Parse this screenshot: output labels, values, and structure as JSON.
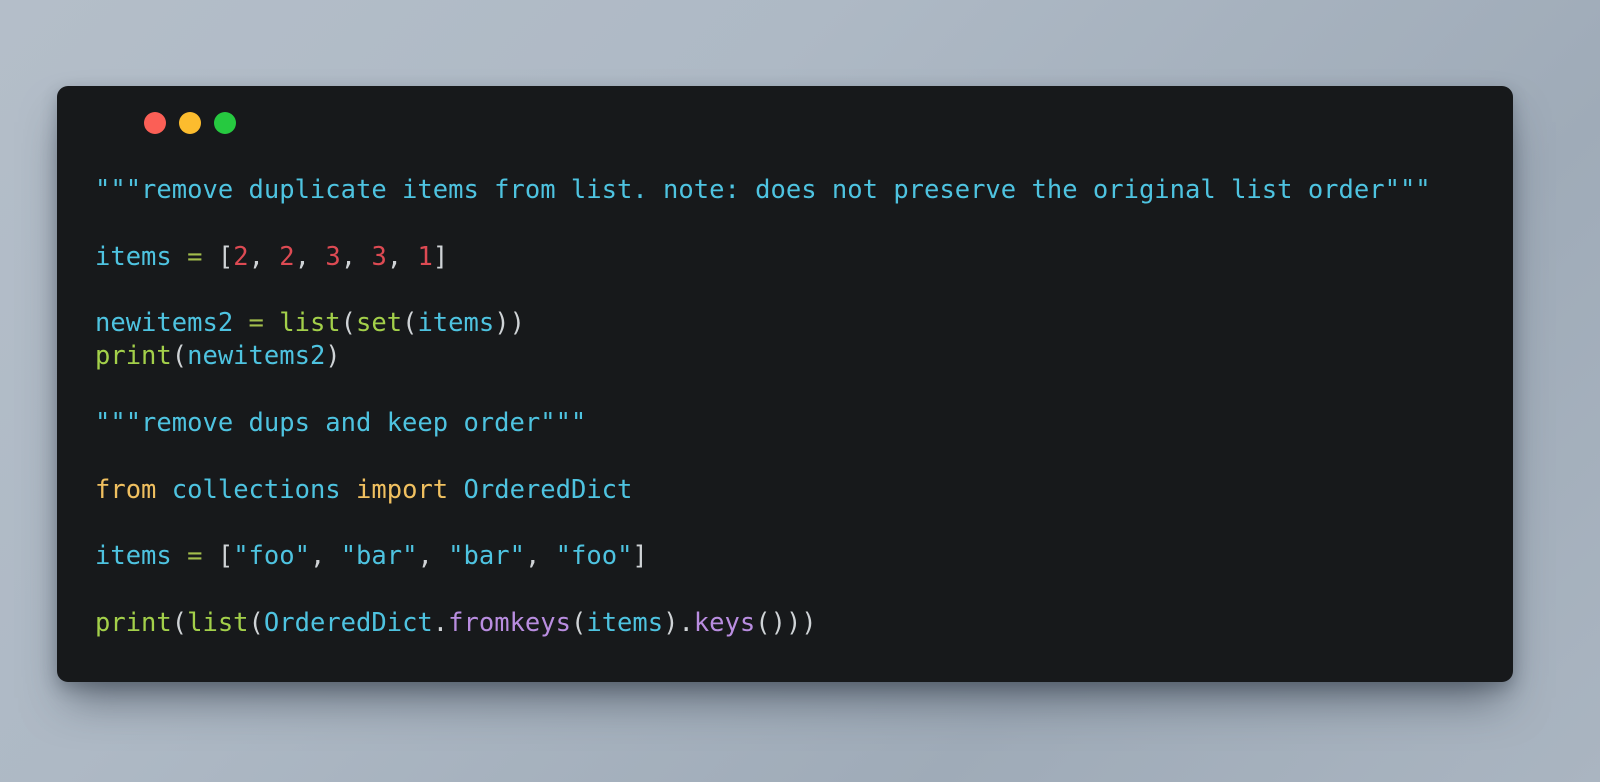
{
  "window": {
    "title": "code-snippet-window",
    "controls": [
      {
        "name": "close",
        "label": "",
        "color": "#fb5f56"
      },
      {
        "name": "minimize",
        "label": "",
        "color": "#fcbc2e"
      },
      {
        "name": "maximize",
        "label": "",
        "color": "#26c940"
      }
    ]
  },
  "theme": {
    "background": "#aeb9c5",
    "card_background": "#17191b",
    "comment": "#4ec3e0",
    "variable": "#4ec3e0",
    "string": "#4ec3e0",
    "number": "#dd4a53",
    "operator": "#a3be4c",
    "builtin": "#a3d04a",
    "keyword": "#f0c060",
    "method": "#b98de0",
    "punctuation": "#cfd3d6"
  },
  "code": {
    "language": "python",
    "plain_text": "\"\"\"remove duplicate items from list. note: does not preserve the original list order\"\"\"\n\nitems = [2, 2, 3, 3, 1]\n\nnewitems2 = list(set(items))\nprint(newitems2)\n\n\"\"\"remove dups and keep order\"\"\"\n\nfrom collections import OrderedDict\n\nitems = [\"foo\", \"bar\", \"bar\", \"foo\"]\n\nprint(list(OrderedDict.fromkeys(items).keys()))",
    "lines": [
      {
        "index": 1,
        "tokens": [
          {
            "t": "\"\"\"remove duplicate items from list. note: does not preserve the original list order\"\"\"",
            "c": "comment"
          }
        ]
      },
      {
        "index": 2,
        "tokens": []
      },
      {
        "index": 3,
        "tokens": [
          {
            "t": "items",
            "c": "var"
          },
          {
            "t": " ",
            "c": "punct"
          },
          {
            "t": "=",
            "c": "op"
          },
          {
            "t": " ",
            "c": "punct"
          },
          {
            "t": "[",
            "c": "punct"
          },
          {
            "t": "2",
            "c": "num"
          },
          {
            "t": ", ",
            "c": "punct"
          },
          {
            "t": "2",
            "c": "num"
          },
          {
            "t": ", ",
            "c": "punct"
          },
          {
            "t": "3",
            "c": "num"
          },
          {
            "t": ", ",
            "c": "punct"
          },
          {
            "t": "3",
            "c": "num"
          },
          {
            "t": ", ",
            "c": "punct"
          },
          {
            "t": "1",
            "c": "num"
          },
          {
            "t": "]",
            "c": "punct"
          }
        ]
      },
      {
        "index": 4,
        "tokens": []
      },
      {
        "index": 5,
        "tokens": [
          {
            "t": "newitems2",
            "c": "var"
          },
          {
            "t": " ",
            "c": "punct"
          },
          {
            "t": "=",
            "c": "op"
          },
          {
            "t": " ",
            "c": "punct"
          },
          {
            "t": "list",
            "c": "builtin"
          },
          {
            "t": "(",
            "c": "punct"
          },
          {
            "t": "set",
            "c": "builtin"
          },
          {
            "t": "(",
            "c": "punct"
          },
          {
            "t": "items",
            "c": "var"
          },
          {
            "t": "))",
            "c": "punct"
          }
        ]
      },
      {
        "index": 6,
        "tokens": [
          {
            "t": "print",
            "c": "builtin"
          },
          {
            "t": "(",
            "c": "punct"
          },
          {
            "t": "newitems2",
            "c": "var"
          },
          {
            "t": ")",
            "c": "punct"
          }
        ]
      },
      {
        "index": 7,
        "tokens": []
      },
      {
        "index": 8,
        "tokens": [
          {
            "t": "\"\"\"remove dups and keep order\"\"\"",
            "c": "comment"
          }
        ]
      },
      {
        "index": 9,
        "tokens": []
      },
      {
        "index": 10,
        "tokens": [
          {
            "t": "from",
            "c": "keyword"
          },
          {
            "t": " ",
            "c": "punct"
          },
          {
            "t": "collections",
            "c": "var"
          },
          {
            "t": " ",
            "c": "punct"
          },
          {
            "t": "import",
            "c": "keyword"
          },
          {
            "t": " ",
            "c": "punct"
          },
          {
            "t": "OrderedDict",
            "c": "class"
          }
        ]
      },
      {
        "index": 11,
        "tokens": []
      },
      {
        "index": 12,
        "tokens": [
          {
            "t": "items",
            "c": "var"
          },
          {
            "t": " ",
            "c": "punct"
          },
          {
            "t": "=",
            "c": "op"
          },
          {
            "t": " ",
            "c": "punct"
          },
          {
            "t": "[",
            "c": "punct"
          },
          {
            "t": "\"foo\"",
            "c": "string"
          },
          {
            "t": ", ",
            "c": "punct"
          },
          {
            "t": "\"bar\"",
            "c": "string"
          },
          {
            "t": ", ",
            "c": "punct"
          },
          {
            "t": "\"bar\"",
            "c": "string"
          },
          {
            "t": ", ",
            "c": "punct"
          },
          {
            "t": "\"foo\"",
            "c": "string"
          },
          {
            "t": "]",
            "c": "punct"
          }
        ]
      },
      {
        "index": 13,
        "tokens": []
      },
      {
        "index": 14,
        "tokens": [
          {
            "t": "print",
            "c": "builtin"
          },
          {
            "t": "(",
            "c": "punct"
          },
          {
            "t": "list",
            "c": "builtin"
          },
          {
            "t": "(",
            "c": "punct"
          },
          {
            "t": "OrderedDict",
            "c": "class"
          },
          {
            "t": ".",
            "c": "punct"
          },
          {
            "t": "fromkeys",
            "c": "method"
          },
          {
            "t": "(",
            "c": "punct"
          },
          {
            "t": "items",
            "c": "var"
          },
          {
            "t": ")",
            "c": "punct"
          },
          {
            "t": ".",
            "c": "punct"
          },
          {
            "t": "keys",
            "c": "method"
          },
          {
            "t": "()))",
            "c": "punct"
          }
        ]
      }
    ]
  }
}
